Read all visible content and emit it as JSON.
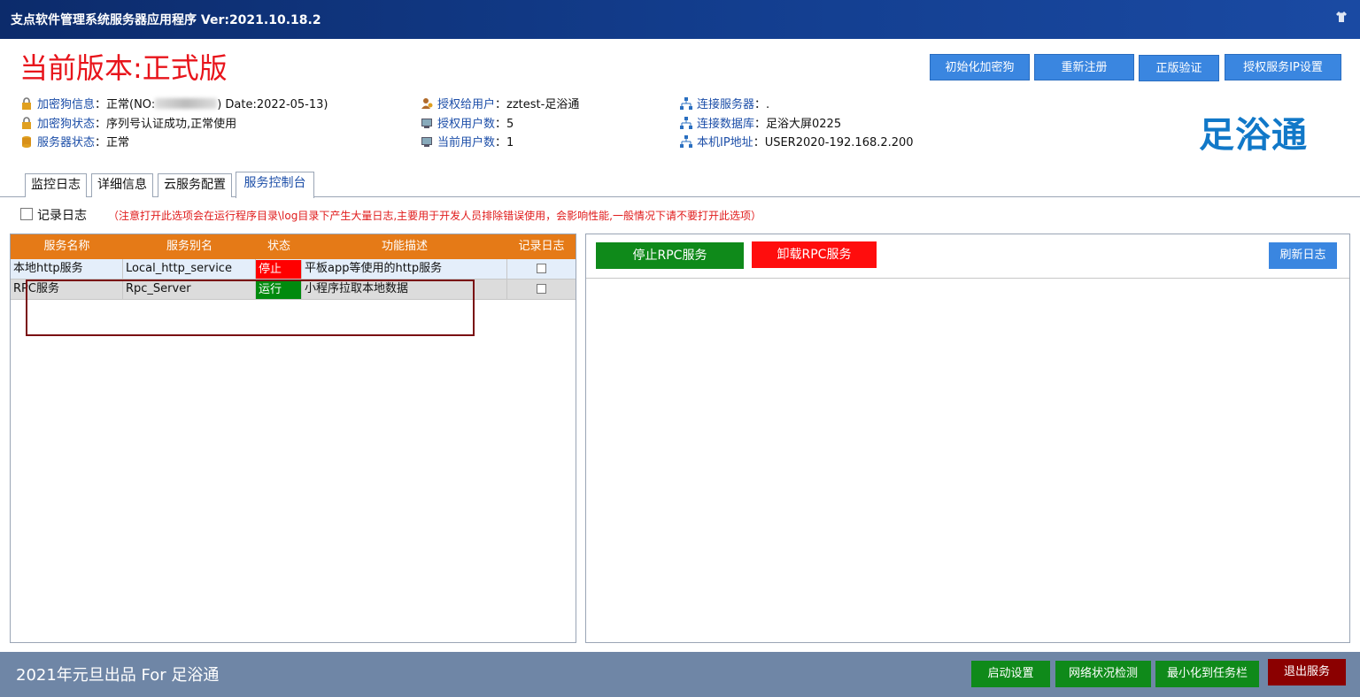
{
  "window": {
    "title": "支点软件管理系统服务器应用程序  Ver:2021.10.18.2",
    "skin_icon": "tshirt-icon"
  },
  "header": {
    "version_label": "当前版本:正式版",
    "buttons": {
      "init_dongle": "初始化加密狗",
      "reregister": "重新注册",
      "verify": "正版验证",
      "auth_ip": "授权服务IP设置"
    },
    "logo_text": "足浴通"
  },
  "info": {
    "col1": [
      {
        "label": "加密狗信息",
        "value_pre": "：正常(NO:",
        "value_post": ") Date:2022-05-13)",
        "icon": "lock-icon"
      },
      {
        "label": "加密狗状态",
        "value": "：序列号认证成功,正常使用",
        "icon": "lock-icon"
      },
      {
        "label": "服务器状态",
        "value": "：正常",
        "icon": "database-icon"
      }
    ],
    "col2": [
      {
        "label": "授权给用户",
        "value": "：zztest-足浴通",
        "icon": "user-icon"
      },
      {
        "label": "授权用户数",
        "value": "：5",
        "icon": "monitor-icon"
      },
      {
        "label": "当前用户数",
        "value": "：1",
        "icon": "monitor-icon"
      }
    ],
    "col3": [
      {
        "label": "连接服务器",
        "value": "：.",
        "icon": "network-icon"
      },
      {
        "label": "连接数据库",
        "value": "：足浴大屏0225",
        "icon": "network-icon"
      },
      {
        "label": "本机IP地址",
        "value": "：USER2020-192.168.2.200",
        "icon": "network-icon"
      }
    ]
  },
  "tabs": [
    "监控日志",
    "详细信息",
    "云服务配置",
    "服务控制台"
  ],
  "active_tab": "服务控制台",
  "log_option": {
    "label": "记录日志",
    "note": "（注意打开此选项会在运行程序目录\\log目录下产生大量日志,主要用于开发人员排除错误使用，会影响性能,一般情况下请不要打开此选项）",
    "checked": false
  },
  "services_table": {
    "headers": [
      "服务名称",
      "服务别名",
      "状态",
      "功能描述",
      "记录日志"
    ],
    "rows": [
      {
        "name": "本地http服务",
        "alias": "Local_http_service",
        "status": "停止",
        "desc": "平板app等使用的http服务",
        "log": false
      },
      {
        "name": "RPC服务",
        "alias": "Rpc_Server",
        "status": "运行",
        "desc": "小程序拉取本地数据",
        "log": false
      }
    ]
  },
  "right_panel": {
    "stop_rpc": "停止RPC服务",
    "uninstall_rpc": "卸载RPC服务",
    "refresh_log": "刷新日志"
  },
  "footer": {
    "slogan": "2021年元旦出品 For 足浴通",
    "buttons": {
      "startup": "启动设置",
      "network_check": "网络状况检测",
      "minimize_tray": "最小化到任务栏",
      "exit": "退出服务"
    }
  },
  "colors": {
    "titlebar": "#133e8f",
    "version_red": "#e8141b",
    "top_button_blue": "#3a86e0",
    "table_header_orange": "#e57a17",
    "stop_red": "#ff0000",
    "run_green": "#008a0e",
    "footer_bg": "#6f86a6",
    "exit_darkred": "#8b0000",
    "footer_green": "#0f8a1a"
  }
}
